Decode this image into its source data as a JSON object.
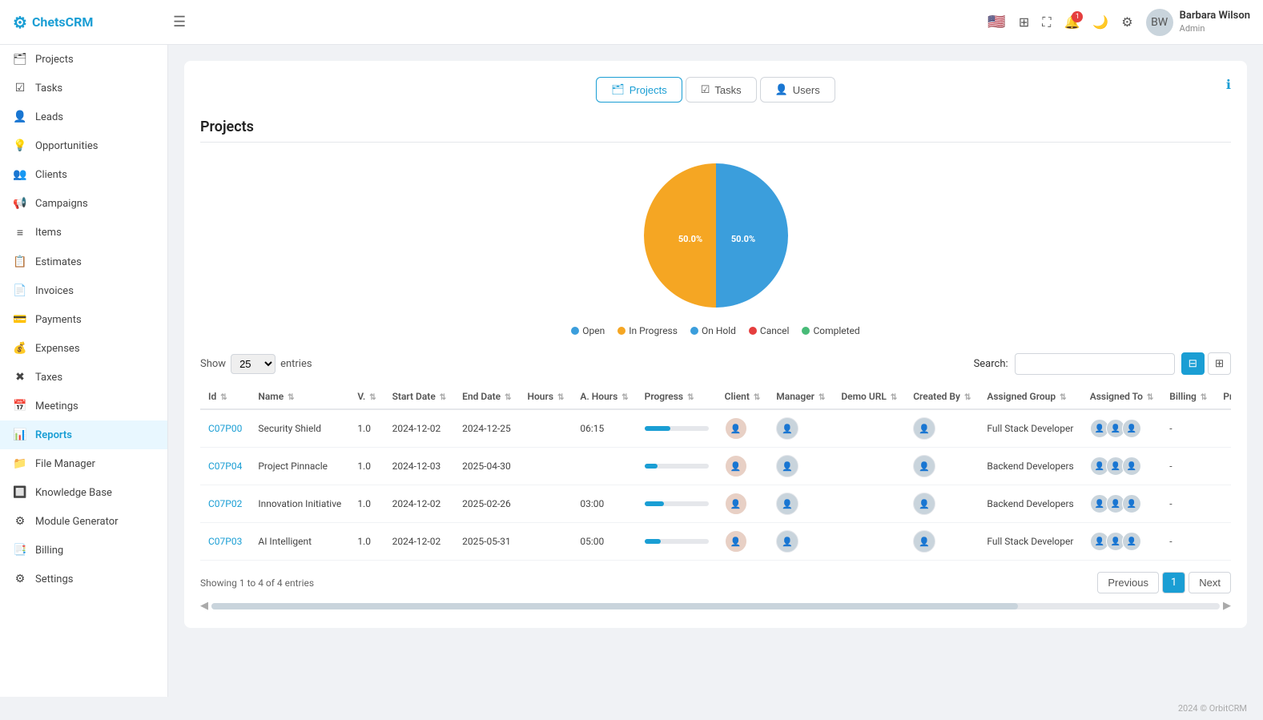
{
  "topbar": {
    "logo_text": "ChetsCRM",
    "hamburger_label": "☰",
    "user": {
      "name": "Barbara Wilson",
      "role": "Admin",
      "initials": "BW"
    },
    "notification_count": "1"
  },
  "sidebar": {
    "items": [
      {
        "id": "projects",
        "label": "Projects",
        "icon": "🗂",
        "active": false
      },
      {
        "id": "tasks",
        "label": "Tasks",
        "icon": "☑",
        "active": false
      },
      {
        "id": "leads",
        "label": "Leads",
        "icon": "👤",
        "active": false
      },
      {
        "id": "opportunities",
        "label": "Opportunities",
        "icon": "💡",
        "active": false
      },
      {
        "id": "clients",
        "label": "Clients",
        "icon": "👥",
        "active": false
      },
      {
        "id": "campaigns",
        "label": "Campaigns",
        "icon": "📢",
        "active": false
      },
      {
        "id": "items",
        "label": "Items",
        "icon": "≡",
        "active": false
      },
      {
        "id": "estimates",
        "label": "Estimates",
        "icon": "📋",
        "active": false
      },
      {
        "id": "invoices",
        "label": "Invoices",
        "icon": "📄",
        "active": false
      },
      {
        "id": "payments",
        "label": "Payments",
        "icon": "💳",
        "active": false
      },
      {
        "id": "expenses",
        "label": "Expenses",
        "icon": "💰",
        "active": false
      },
      {
        "id": "taxes",
        "label": "Taxes",
        "icon": "✖",
        "active": false
      },
      {
        "id": "meetings",
        "label": "Meetings",
        "icon": "📅",
        "active": false
      },
      {
        "id": "reports",
        "label": "Reports",
        "icon": "📊",
        "active": true
      },
      {
        "id": "file-manager",
        "label": "File Manager",
        "icon": "📁",
        "active": false
      },
      {
        "id": "knowledge-base",
        "label": "Knowledge Base",
        "icon": "🔲",
        "active": false
      },
      {
        "id": "module-generator",
        "label": "Module Generator",
        "icon": "⚙",
        "active": false
      },
      {
        "id": "billing",
        "label": "Billing",
        "icon": "📑",
        "active": false
      },
      {
        "id": "settings",
        "label": "Settings",
        "icon": "⚙",
        "active": false
      }
    ]
  },
  "tabs": [
    {
      "id": "projects",
      "label": "Projects",
      "icon": "🗂",
      "active": true
    },
    {
      "id": "tasks",
      "label": "Tasks",
      "icon": "☑",
      "active": false
    },
    {
      "id": "users",
      "label": "Users",
      "icon": "👤",
      "active": false
    }
  ],
  "page_title": "Projects",
  "chart": {
    "segments": [
      {
        "label": "Open",
        "value": 0,
        "color": "#3b9edc",
        "pct": 0
      },
      {
        "label": "In Progress",
        "value": 50,
        "color": "#f5a623",
        "pct": 50,
        "text": "50.0%"
      },
      {
        "label": "On Hold",
        "value": 50,
        "color": "#3b9edc",
        "pct": 50,
        "text": "50.0%"
      },
      {
        "label": "Cancel",
        "value": 0,
        "color": "#e53e3e",
        "pct": 0
      },
      {
        "label": "Completed",
        "value": 0,
        "color": "#48bb78",
        "pct": 0
      }
    ]
  },
  "table_controls": {
    "show_label": "Show",
    "show_value": "25",
    "entries_label": "entries",
    "search_label": "Search:",
    "search_placeholder": ""
  },
  "table": {
    "columns": [
      "Id",
      "Name",
      "V.",
      "Start Date",
      "End Date",
      "Hours",
      "A. Hours",
      "Progress",
      "Client",
      "Manager",
      "Demo URL",
      "Created By",
      "Assigned Group",
      "Assigned To",
      "Billing",
      "Price"
    ],
    "rows": [
      {
        "id": "C07P00",
        "name": "Security Shield",
        "version": "1.0",
        "start_date": "2024-12-02",
        "end_date": "2024-12-25",
        "hours": "",
        "actual_hours": "06:15",
        "progress": 40,
        "assigned_group": "Full Stack Developer",
        "billing": "-"
      },
      {
        "id": "C07P04",
        "name": "Project Pinnacle",
        "version": "1.0",
        "start_date": "2024-12-03",
        "end_date": "2025-04-30",
        "hours": "",
        "actual_hours": "",
        "progress": 20,
        "assigned_group": "Backend Developers",
        "billing": "-"
      },
      {
        "id": "C07P02",
        "name": "Innovation Initiative",
        "version": "1.0",
        "start_date": "2024-12-02",
        "end_date": "2025-02-26",
        "hours": "",
        "actual_hours": "03:00",
        "progress": 30,
        "assigned_group": "Backend Developers",
        "billing": "-"
      },
      {
        "id": "C07P03",
        "name": "AI Intelligent",
        "version": "1.0",
        "start_date": "2024-12-02",
        "end_date": "2025-05-31",
        "hours": "",
        "actual_hours": "05:00",
        "progress": 25,
        "assigned_group": "Full Stack Developer",
        "billing": "-"
      }
    ]
  },
  "pagination": {
    "showing_text": "Showing 1 to 4 of 4 entries",
    "previous_label": "Previous",
    "next_label": "Next",
    "current_page": "1"
  },
  "footer": {
    "text": "2024 © OrbitCRM"
  }
}
